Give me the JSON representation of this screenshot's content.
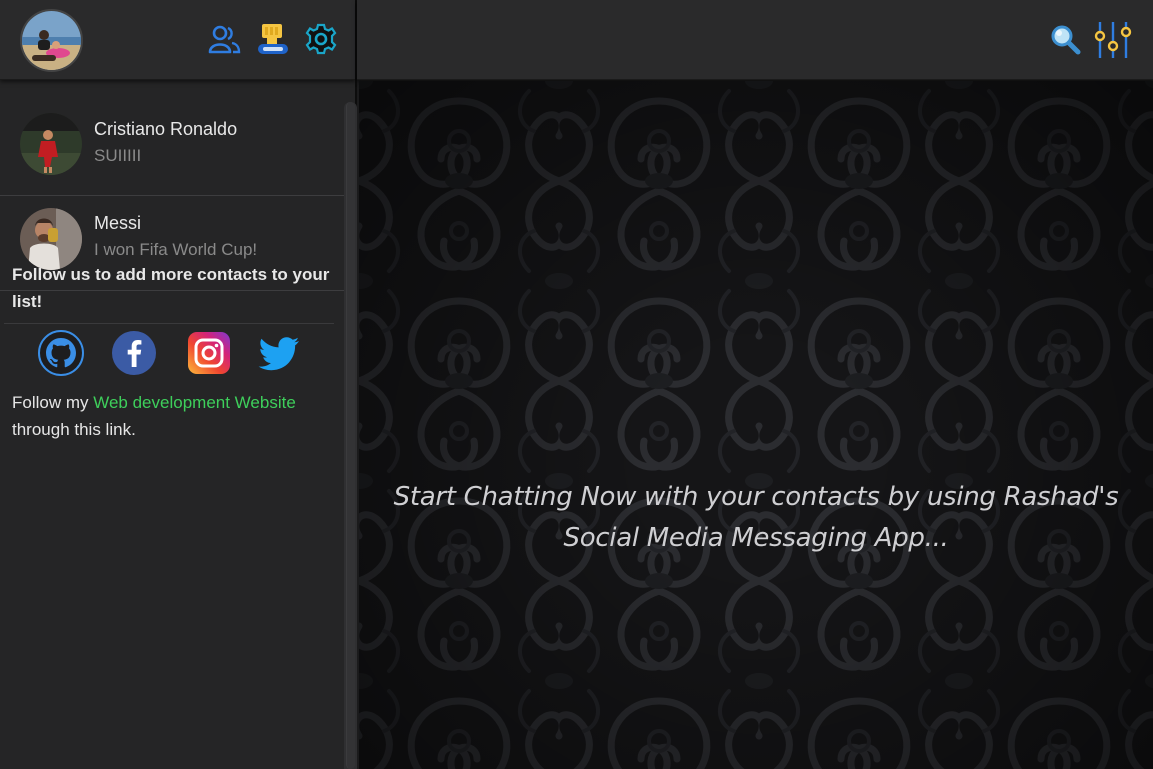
{
  "sidebar": {
    "header": {
      "profile_avatar": "user-profile-avatar",
      "icons": [
        "contacts-icon",
        "status-icon",
        "settings-icon"
      ]
    },
    "contacts": [
      {
        "name": "Cristiano Ronaldo",
        "last_message": "SUIIIII"
      },
      {
        "name": "Messi",
        "last_message": "I won Fifa World Cup!"
      }
    ],
    "follow": {
      "heading": "Follow us to add more contacts to your list!",
      "social": [
        "github-icon",
        "facebook-icon",
        "instagram-icon",
        "twitter-icon"
      ],
      "text_before": "Follow my ",
      "link_text": "Web development Website",
      "text_after": " through this link."
    }
  },
  "main": {
    "header_icons": [
      "search-icon",
      "filter-icon"
    ],
    "placeholder": "Start Chatting Now with your contacts by using Rashad's Social Media Messaging App..."
  },
  "colors": {
    "background": "#1b1b1c",
    "sidebar": "#252526",
    "header": "#2a2a2b",
    "link": "#3ecf5b",
    "muted_text": "#8a8a8a"
  }
}
